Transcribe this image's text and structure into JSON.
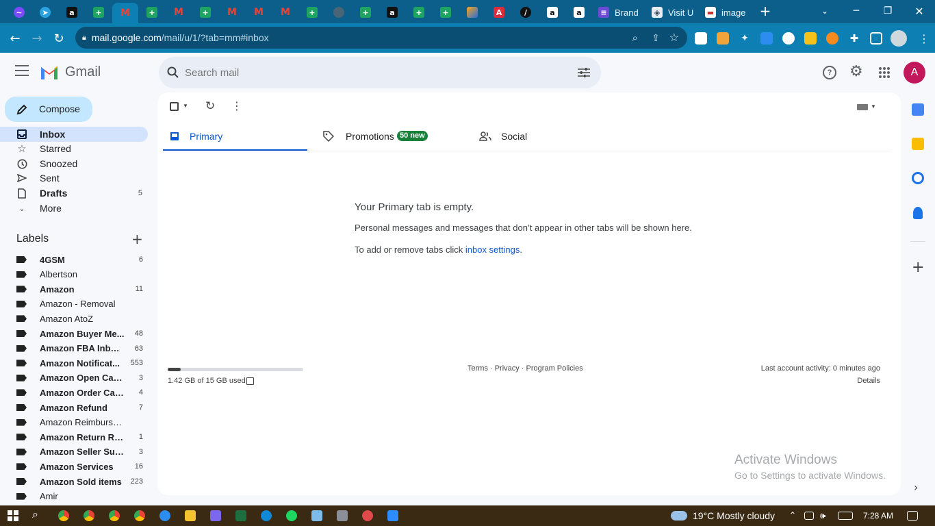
{
  "browser": {
    "tabs_wide": [
      {
        "label": "Brand"
      },
      {
        "label": "Visit U"
      },
      {
        "label": "image"
      }
    ],
    "url_host": "mail.google.com",
    "url_path": "/mail/u/1/?tab=mm#inbox"
  },
  "gmail": {
    "app_name": "Gmail",
    "search_placeholder": "Search mail",
    "avatar_letter": "A",
    "compose_label": "Compose",
    "nav": [
      {
        "label": "Inbox",
        "count": "",
        "icon": "inbox-icon"
      },
      {
        "label": "Starred",
        "count": "",
        "icon": "star-icon"
      },
      {
        "label": "Snoozed",
        "count": "",
        "icon": "clock-icon"
      },
      {
        "label": "Sent",
        "count": "",
        "icon": "send-icon"
      },
      {
        "label": "Drafts",
        "count": "5",
        "icon": "draft-icon"
      },
      {
        "label": "More",
        "count": "",
        "icon": "chevron-down-icon"
      }
    ],
    "labels_heading": "Labels",
    "labels": [
      {
        "label": "4GSM",
        "count": "6",
        "bold": true
      },
      {
        "label": "Albertson",
        "count": "",
        "bold": false
      },
      {
        "label": "Amazon",
        "count": "11",
        "bold": true
      },
      {
        "label": "Amazon - Removal",
        "count": "",
        "bold": false
      },
      {
        "label": "Amazon AtoZ",
        "count": "",
        "bold": false
      },
      {
        "label": "Amazon Buyer Me...",
        "count": "48",
        "bold": true
      },
      {
        "label": "Amazon FBA Inbou...",
        "count": "63",
        "bold": true
      },
      {
        "label": "Amazon Notificat...",
        "count": "553",
        "bold": true
      },
      {
        "label": "Amazon Open Case...",
        "count": "3",
        "bold": true
      },
      {
        "label": "Amazon Order Can...",
        "count": "4",
        "bold": true
      },
      {
        "label": "Amazon Refund",
        "count": "7",
        "bold": true
      },
      {
        "label": "Amazon Reimbursement",
        "count": "",
        "bold": false
      },
      {
        "label": "Amazon Return Req...",
        "count": "1",
        "bold": true
      },
      {
        "label": "Amazon Seller Supp...",
        "count": "3",
        "bold": true
      },
      {
        "label": "Amazon Services",
        "count": "16",
        "bold": true
      },
      {
        "label": "Amazon Sold items",
        "count": "223",
        "bold": true
      },
      {
        "label": "Amir",
        "count": "",
        "bold": false
      }
    ],
    "tabs": [
      {
        "label": "Primary",
        "badge": ""
      },
      {
        "label": "Promotions",
        "badge": "50 new"
      },
      {
        "label": "Social",
        "badge": ""
      }
    ],
    "empty": {
      "title": "Your Primary tab is empty.",
      "line1": "Personal messages and messages that don’t appear in other tabs will be shown here.",
      "line2_prefix": "To add or remove tabs click ",
      "line2_link": "inbox settings",
      "line2_suffix": "."
    },
    "footer": {
      "storage_text": "1.42 GB of 15 GB used",
      "storage_fraction": 0.095,
      "links": "Terms · Privacy · Program Policies",
      "activity": "Last account activity: 0 minutes ago",
      "details": "Details"
    },
    "watermark": {
      "title": "Activate Windows",
      "subtitle": "Go to Settings to activate Windows."
    }
  },
  "taskbar": {
    "weather": "19°C  Mostly cloudy",
    "time": "7:28 AM"
  },
  "colors": {
    "chrome_strip": "#0b5f8a",
    "chrome_toolbar": "#0e7fb3",
    "gmail_accent": "#0b57d0",
    "compose_bg": "#c2e7ff",
    "inbox_selected": "#d3e3fd",
    "promo_badge": "#188038",
    "taskbar": "#3a2a14"
  }
}
